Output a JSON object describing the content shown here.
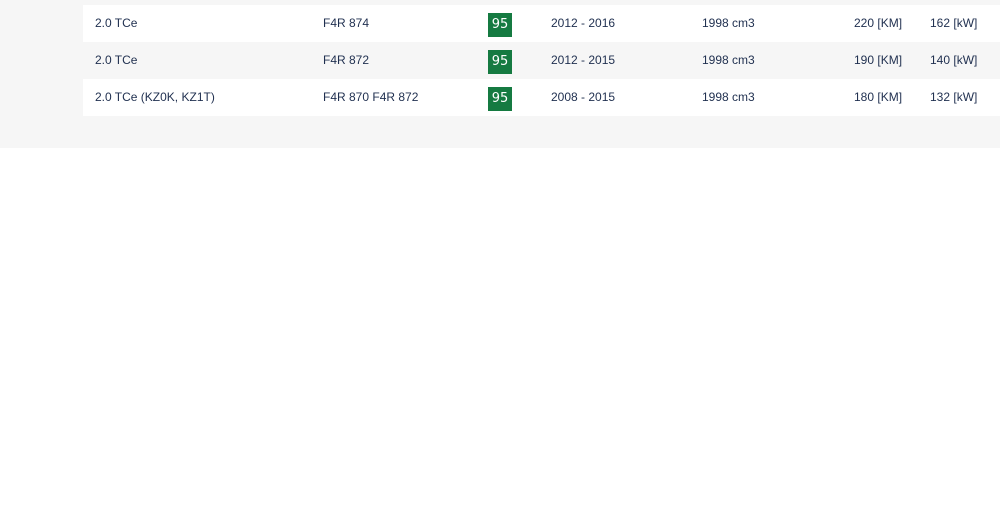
{
  "colors": {
    "panel_bg": "#f6f6f6",
    "row_alt_bg": "#ffffff",
    "text": "#1f2f4f",
    "badge_bg": "#157a41"
  },
  "rows": [
    {
      "name": "2.0 TCe",
      "engine_code": "F4R 874",
      "badge": "95",
      "years": "2012 - 2016",
      "capacity": "1998 cm3",
      "power_km": "220 [KM]",
      "power_kw": "162 [kW]"
    },
    {
      "name": "2.0 TCe",
      "engine_code": "F4R 872",
      "badge": "95",
      "years": "2012 - 2015",
      "capacity": "1998 cm3",
      "power_km": "190 [KM]",
      "power_kw": "140 [kW]"
    },
    {
      "name": "2.0 TCe (KZ0K, KZ1T)",
      "engine_code": "F4R 870 F4R 872",
      "badge": "95",
      "years": "2008 - 2015",
      "capacity": "1998 cm3",
      "power_km": "180 [KM]",
      "power_kw": "132 [kW]"
    }
  ]
}
